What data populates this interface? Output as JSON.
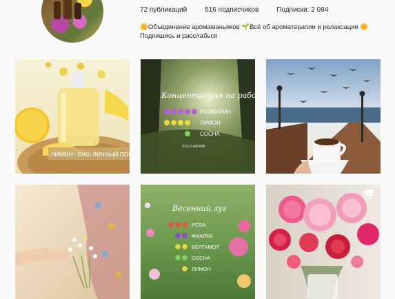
{
  "profile": {
    "avatar_icon": "profile-avatar",
    "stats": {
      "posts_count": "72",
      "posts_label": " публикаций",
      "followers_count": "516",
      "followers_label": " подписчиков",
      "following_label": "Подписки: ",
      "following_count": "2 084"
    },
    "bio": {
      "line1": "🌼Объединение аромаманьяков 🌱Всё об ароматерапии и релаксации 🌼",
      "line2": "Подпишись и расслабься"
    }
  },
  "posts": [
    {
      "id": "post-1",
      "caption": "ЛИМОН - ВАШ ЛИЧНЫЙ ПОМОЩНИК",
      "theme": "lemon-oil"
    },
    {
      "id": "post-2",
      "title": "Концентрация на работе",
      "rows": [
        "РОЗМАРИН",
        "ЛИМОН",
        "СОСНА"
      ],
      "footer": "GOLD AROMA",
      "theme": "forest"
    },
    {
      "id": "post-3",
      "theme": "seagulls-coffee"
    },
    {
      "id": "post-4",
      "theme": "flowers-hand"
    },
    {
      "id": "post-5",
      "title": "Весенний луг",
      "rows": [
        "РОЗА",
        "ФИАЛКА",
        "БЕРГАМОТ",
        "СОСНА",
        "ЛИМОН"
      ],
      "theme": "meadow"
    },
    {
      "id": "post-6",
      "theme": "peonies",
      "icon": "multiple-photos-icon"
    }
  ],
  "colors": {
    "lilac_drop": "#b760d6",
    "yellow_drop": "#e6dc3a",
    "green_drop": "#7ed35a",
    "red_drop": "#e2563d",
    "purple_drop": "#8f4ad0"
  }
}
